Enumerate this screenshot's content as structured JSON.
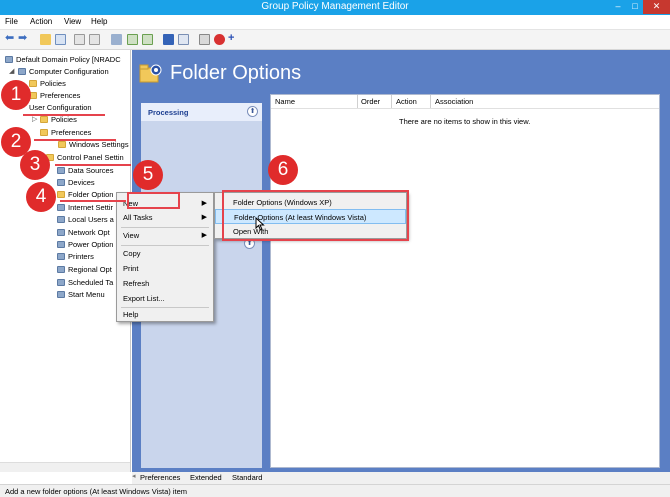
{
  "window": {
    "title": "Group Policy Management Editor"
  },
  "menubar": {
    "file": "File",
    "action": "Action",
    "view": "View",
    "help": "Help"
  },
  "tree": {
    "root": "Default Domain Policy [NRADC",
    "computer_config": "Computer Configuration",
    "cc_policies": "Policies",
    "cc_preferences": "Preferences",
    "user_config": "User Configuration",
    "uc_policies": "Policies",
    "uc_preferences": "Preferences",
    "windows_settings": "Windows Settings",
    "control_panel": "Control Panel Settin",
    "items": [
      "Data Sources",
      "Devices",
      "Folder Option",
      "Internet Settir",
      "Local Users a",
      "Network Opt",
      "Power Option",
      "Printers",
      "Regional Opt",
      "Scheduled Ta",
      "Start Menu"
    ]
  },
  "main": {
    "heading": "Folder Options",
    "processing": "Processing",
    "empty": "There are no items to show in this view."
  },
  "columns": [
    "Name",
    "Order",
    "Action",
    "Association"
  ],
  "context_menu": {
    "new": "New",
    "all_tasks": "All Tasks",
    "view": "View",
    "copy": "Copy",
    "print": "Print",
    "refresh": "Refresh",
    "export": "Export List...",
    "help": "Help"
  },
  "submenu": {
    "xp": "Folder Options (Windows XP)",
    "vista": "Folder Options (At least Windows Vista)",
    "open_with": "Open With"
  },
  "tabs": [
    "Preferences",
    "Extended",
    "Standard"
  ],
  "status": "Add a new folder options (At least Windows Vista) item",
  "steps": [
    "1",
    "2",
    "3",
    "4",
    "5",
    "6"
  ],
  "colors": {
    "title_bar": "#1aa2e8",
    "pane_blue": "#5b7fc4",
    "annotation_red": "#e02b2b"
  }
}
